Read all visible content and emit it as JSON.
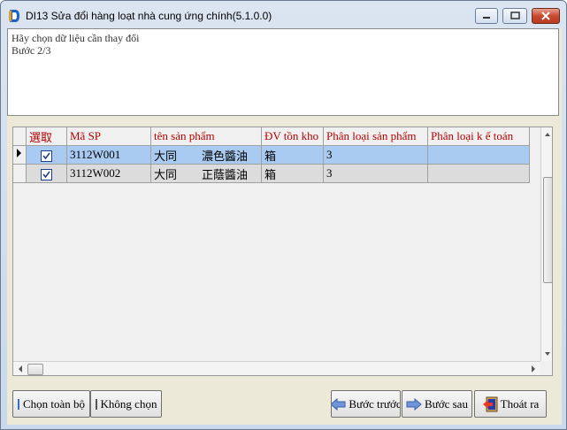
{
  "window": {
    "title": "DI13 Sửa đổi hàng loạt nhà cung ứng chính(5.1.0.0)"
  },
  "info": {
    "line1": "Hãy chọn dữ liệu cần thay đổi",
    "line2": "Bước 2/3"
  },
  "grid": {
    "columns": [
      "選取",
      "Mã SP",
      "tên sản phẩm",
      "ĐV tồn kho",
      "Phân loại sản phẩm",
      "Phân loại k ế toán"
    ],
    "rows": [
      {
        "checked": true,
        "code": "3112W001",
        "name_a": "大同",
        "name_b": "濃色醬油",
        "unit": "箱",
        "category": "3",
        "acct": ""
      },
      {
        "checked": true,
        "code": "3112W002",
        "name_a": "大同",
        "name_b": "正蔭醬油",
        "unit": "箱",
        "category": "3",
        "acct": ""
      }
    ]
  },
  "buttons": {
    "select_all": "Chọn toàn bộ",
    "select_none": "Không chọn",
    "prev": "Bước trước",
    "next": "Bước sau",
    "exit": "Thoát ra"
  },
  "colors": {
    "selected_row": "#a9cbf2",
    "header_text": "#b40000"
  }
}
